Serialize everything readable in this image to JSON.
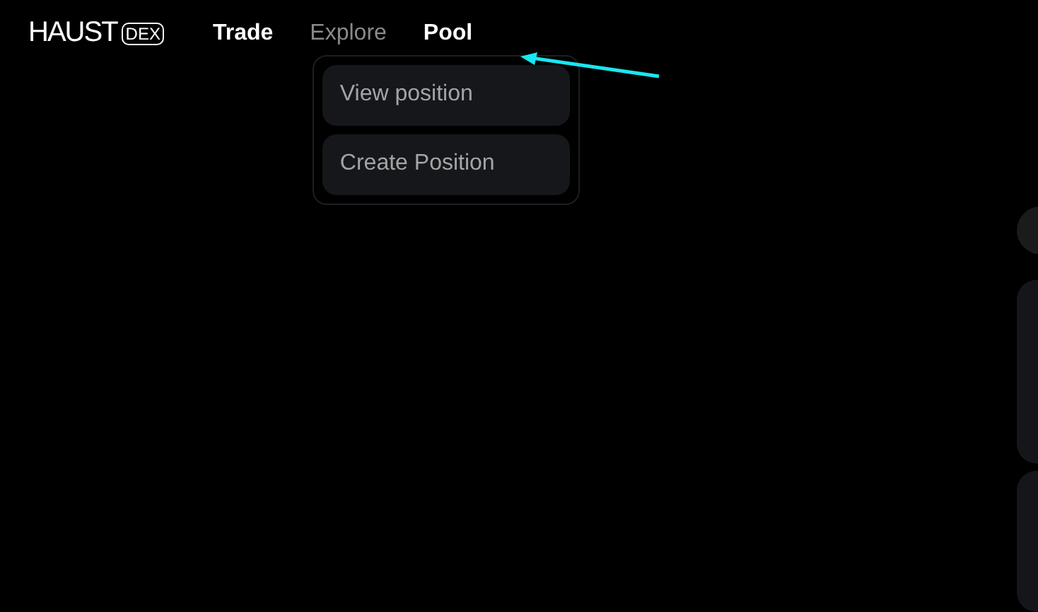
{
  "logo": {
    "name": "HAUST",
    "badge": "DEX"
  },
  "nav": [
    {
      "label": "Trade",
      "muted": false
    },
    {
      "label": "Explore",
      "muted": true
    },
    {
      "label": "Pool",
      "muted": false,
      "menu": [
        "View position",
        "Create Position"
      ]
    }
  ]
}
